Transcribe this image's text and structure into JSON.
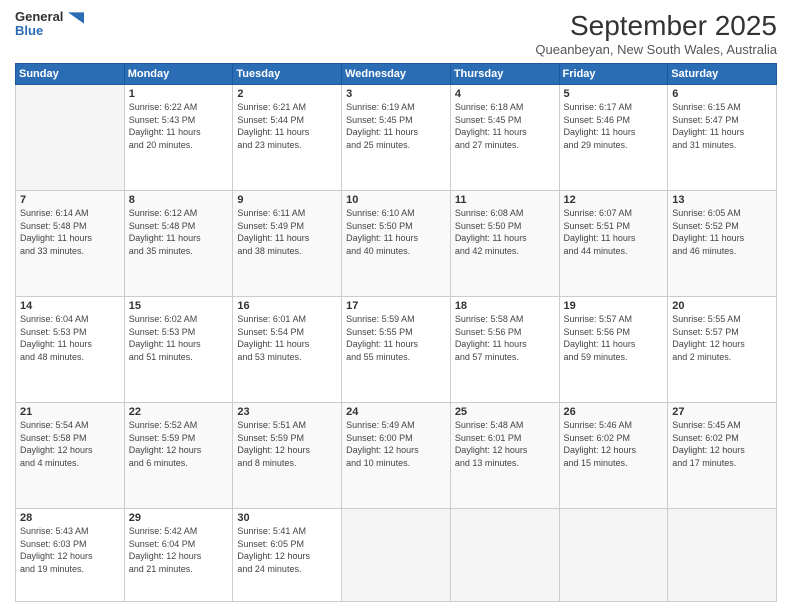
{
  "header": {
    "logo_line1": "General",
    "logo_line2": "Blue",
    "title": "September 2025",
    "subtitle": "Queanbeyan, New South Wales, Australia"
  },
  "days_header": [
    "Sunday",
    "Monday",
    "Tuesday",
    "Wednesday",
    "Thursday",
    "Friday",
    "Saturday"
  ],
  "weeks": [
    [
      {
        "day": "",
        "info": ""
      },
      {
        "day": "1",
        "info": "Sunrise: 6:22 AM\nSunset: 5:43 PM\nDaylight: 11 hours\nand 20 minutes."
      },
      {
        "day": "2",
        "info": "Sunrise: 6:21 AM\nSunset: 5:44 PM\nDaylight: 11 hours\nand 23 minutes."
      },
      {
        "day": "3",
        "info": "Sunrise: 6:19 AM\nSunset: 5:45 PM\nDaylight: 11 hours\nand 25 minutes."
      },
      {
        "day": "4",
        "info": "Sunrise: 6:18 AM\nSunset: 5:45 PM\nDaylight: 11 hours\nand 27 minutes."
      },
      {
        "day": "5",
        "info": "Sunrise: 6:17 AM\nSunset: 5:46 PM\nDaylight: 11 hours\nand 29 minutes."
      },
      {
        "day": "6",
        "info": "Sunrise: 6:15 AM\nSunset: 5:47 PM\nDaylight: 11 hours\nand 31 minutes."
      }
    ],
    [
      {
        "day": "7",
        "info": "Sunrise: 6:14 AM\nSunset: 5:48 PM\nDaylight: 11 hours\nand 33 minutes."
      },
      {
        "day": "8",
        "info": "Sunrise: 6:12 AM\nSunset: 5:48 PM\nDaylight: 11 hours\nand 35 minutes."
      },
      {
        "day": "9",
        "info": "Sunrise: 6:11 AM\nSunset: 5:49 PM\nDaylight: 11 hours\nand 38 minutes."
      },
      {
        "day": "10",
        "info": "Sunrise: 6:10 AM\nSunset: 5:50 PM\nDaylight: 11 hours\nand 40 minutes."
      },
      {
        "day": "11",
        "info": "Sunrise: 6:08 AM\nSunset: 5:50 PM\nDaylight: 11 hours\nand 42 minutes."
      },
      {
        "day": "12",
        "info": "Sunrise: 6:07 AM\nSunset: 5:51 PM\nDaylight: 11 hours\nand 44 minutes."
      },
      {
        "day": "13",
        "info": "Sunrise: 6:05 AM\nSunset: 5:52 PM\nDaylight: 11 hours\nand 46 minutes."
      }
    ],
    [
      {
        "day": "14",
        "info": "Sunrise: 6:04 AM\nSunset: 5:53 PM\nDaylight: 11 hours\nand 48 minutes."
      },
      {
        "day": "15",
        "info": "Sunrise: 6:02 AM\nSunset: 5:53 PM\nDaylight: 11 hours\nand 51 minutes."
      },
      {
        "day": "16",
        "info": "Sunrise: 6:01 AM\nSunset: 5:54 PM\nDaylight: 11 hours\nand 53 minutes."
      },
      {
        "day": "17",
        "info": "Sunrise: 5:59 AM\nSunset: 5:55 PM\nDaylight: 11 hours\nand 55 minutes."
      },
      {
        "day": "18",
        "info": "Sunrise: 5:58 AM\nSunset: 5:56 PM\nDaylight: 11 hours\nand 57 minutes."
      },
      {
        "day": "19",
        "info": "Sunrise: 5:57 AM\nSunset: 5:56 PM\nDaylight: 11 hours\nand 59 minutes."
      },
      {
        "day": "20",
        "info": "Sunrise: 5:55 AM\nSunset: 5:57 PM\nDaylight: 12 hours\nand 2 minutes."
      }
    ],
    [
      {
        "day": "21",
        "info": "Sunrise: 5:54 AM\nSunset: 5:58 PM\nDaylight: 12 hours\nand 4 minutes."
      },
      {
        "day": "22",
        "info": "Sunrise: 5:52 AM\nSunset: 5:59 PM\nDaylight: 12 hours\nand 6 minutes."
      },
      {
        "day": "23",
        "info": "Sunrise: 5:51 AM\nSunset: 5:59 PM\nDaylight: 12 hours\nand 8 minutes."
      },
      {
        "day": "24",
        "info": "Sunrise: 5:49 AM\nSunset: 6:00 PM\nDaylight: 12 hours\nand 10 minutes."
      },
      {
        "day": "25",
        "info": "Sunrise: 5:48 AM\nSunset: 6:01 PM\nDaylight: 12 hours\nand 13 minutes."
      },
      {
        "day": "26",
        "info": "Sunrise: 5:46 AM\nSunset: 6:02 PM\nDaylight: 12 hours\nand 15 minutes."
      },
      {
        "day": "27",
        "info": "Sunrise: 5:45 AM\nSunset: 6:02 PM\nDaylight: 12 hours\nand 17 minutes."
      }
    ],
    [
      {
        "day": "28",
        "info": "Sunrise: 5:43 AM\nSunset: 6:03 PM\nDaylight: 12 hours\nand 19 minutes."
      },
      {
        "day": "29",
        "info": "Sunrise: 5:42 AM\nSunset: 6:04 PM\nDaylight: 12 hours\nand 21 minutes."
      },
      {
        "day": "30",
        "info": "Sunrise: 5:41 AM\nSunset: 6:05 PM\nDaylight: 12 hours\nand 24 minutes."
      },
      {
        "day": "",
        "info": ""
      },
      {
        "day": "",
        "info": ""
      },
      {
        "day": "",
        "info": ""
      },
      {
        "day": "",
        "info": ""
      }
    ]
  ]
}
